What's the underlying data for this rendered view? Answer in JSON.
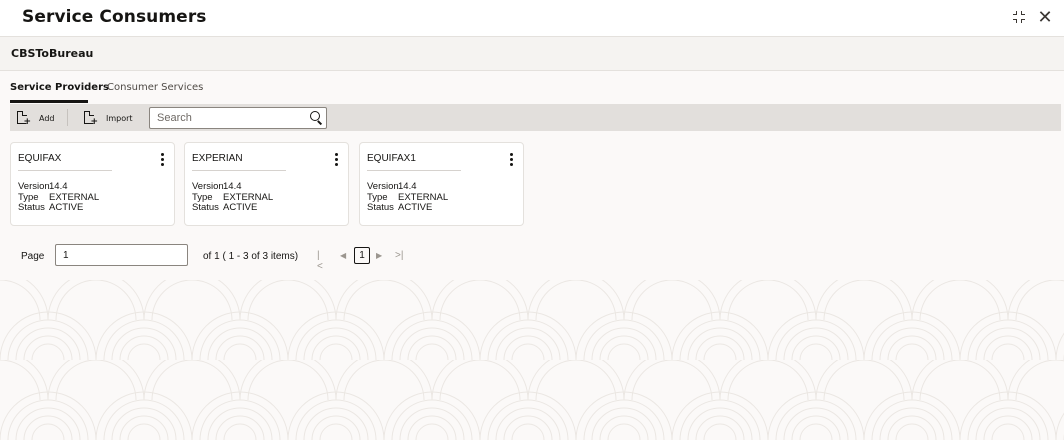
{
  "window": {
    "title": "Service Consumers",
    "minimize_icon": "minimize-icon",
    "close_icon": "close-icon",
    "close_glyph": "✕"
  },
  "subheader": {
    "title": "CBSToBureau"
  },
  "tabs": [
    {
      "label": "Service Providers",
      "active": true
    },
    {
      "label": "Consumer Services",
      "active": false
    }
  ],
  "toolbar": {
    "add_label": "Add",
    "import_label": "Import",
    "search": {
      "placeholder": "Search",
      "value": ""
    }
  },
  "cards": [
    {
      "name": "EQUIFAX",
      "version_label": "Version",
      "version": "14.4",
      "type_label": "Type",
      "type": "EXTERNAL",
      "status_label": "Status",
      "status": "ACTIVE"
    },
    {
      "name": "EXPERIAN",
      "version_label": "Version",
      "version": "14.4",
      "type_label": "Type",
      "type": "EXTERNAL",
      "status_label": "Status",
      "status": "ACTIVE"
    },
    {
      "name": "EQUIFAX1",
      "version_label": "Version",
      "version": "14.4",
      "type_label": "Type",
      "type": "EXTERNAL",
      "status_label": "Status",
      "status": "ACTIVE"
    }
  ],
  "pagination": {
    "page_label": "Page",
    "page_value": "1",
    "of_text": "of 1   ( 1 - 3 of 3 items)",
    "first_glyph": "|<",
    "prev_glyph": "◀",
    "current_page": "1",
    "next_glyph": "▶",
    "last_glyph": ">|"
  },
  "colors": {
    "background": "#fbf9f8",
    "toolbar": "#e2dfdc",
    "text": "#161513"
  }
}
